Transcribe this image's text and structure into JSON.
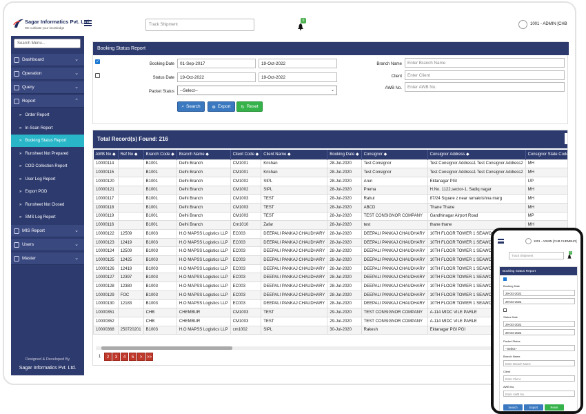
{
  "brand": {
    "name": "Sagar Informatics Pvt. Ltd.",
    "tagline": "We cultivate your knowledge"
  },
  "header": {
    "track_placeholder": "Track Shipment",
    "notif_count": "0",
    "user": "1001 - ADMIN [CHB"
  },
  "sidebar": {
    "search_placeholder": "Search Menu...",
    "items": [
      {
        "label": "Dashboard"
      },
      {
        "label": "Operation"
      },
      {
        "label": "Query"
      },
      {
        "label": "Report"
      }
    ],
    "report_subitems": [
      {
        "label": "Order Report"
      },
      {
        "label": "In-Scan Report"
      },
      {
        "label": "Booking Status Report"
      },
      {
        "label": "Runsheet Not Prepared"
      },
      {
        "label": "COD Collection Report"
      },
      {
        "label": "User Log Report"
      },
      {
        "label": "Export POD"
      },
      {
        "label": "Runsheet Not Closed"
      },
      {
        "label": "SMS Log Report"
      }
    ],
    "bottom_items": [
      {
        "label": "MIS Report"
      },
      {
        "label": "Users"
      },
      {
        "label": "Master"
      }
    ],
    "designed_by": "Designed & Developed By",
    "company": "Sagar Informatics Pvt. Ltd."
  },
  "form": {
    "title": "Booking Status Report",
    "booking_date_label": "Booking Date",
    "booking_from": "01-Sep-2017",
    "booking_to": "19-Oct-2022",
    "status_date_label": "Status Date",
    "status_from": "19-Oct-2022",
    "status_to": "19-Oct-2022",
    "packet_status_label": "Packet Status",
    "packet_status_value": "--Select--",
    "branch_label": "Branch Name",
    "branch_placeholder": "Enter Branch Name",
    "client_label": "Client",
    "client_placeholder": "Enter Client",
    "awb_label": "AWB No.",
    "awb_placeholder": "Enter AWB No.",
    "search_btn": "Search",
    "export_btn": "Export",
    "reset_btn": "Reset"
  },
  "table": {
    "total": "Total Record(s) Found: 216",
    "columns": [
      "AWB No ◆",
      "Ref No ◆",
      "Branch Code ◆",
      "Branch Name ◆",
      "Client Code ◆",
      "Client Name ◆",
      "Booking Date ◆",
      "Consignor ◆",
      "Consignor Address ◆",
      "Consignor State Code ◆",
      "Consignor S"
    ],
    "rows": [
      [
        "10000114",
        "",
        "B1001",
        "Delhi Branch",
        "CM1001",
        "Krishan",
        "28-Jul-2020",
        "Test Consignor",
        "Test Consignor Address1 Test Consignor Address2",
        "MH",
        "MAHARASH"
      ],
      [
        "10000115",
        "",
        "B1001",
        "Delhi Branch",
        "CM1001",
        "Krishan",
        "28-Jul-2020",
        "Test Consignor",
        "Test Consignor Address1 Test Consignor Address2",
        "MH",
        "MAHARASH"
      ],
      [
        "10000120",
        "",
        "B1001",
        "Delhi Branch",
        "CM1002",
        "SIPL",
        "28-Jul-2020",
        "Arun",
        "Ektanagar PGI",
        "UP",
        "Uttar Prades"
      ],
      [
        "10000121",
        "",
        "B1001",
        "Delhi Branch",
        "CM1002",
        "SIPL",
        "28-Jul-2020",
        "Prema",
        "H.No. 1122,sector-1, Sadiq nagar",
        "MH",
        "MAHARASH"
      ],
      [
        "10000117",
        "",
        "B1001",
        "Delhi Branch",
        "CM1003",
        "TEST",
        "28-Jul-2020",
        "Rahul",
        "87/24 Square z near ramakrishna marg",
        "MH",
        "MAHARASH"
      ],
      [
        "10000118",
        "",
        "B1001",
        "Delhi Branch",
        "CM1003",
        "TEST",
        "28-Jul-2020",
        "ABCD",
        "Thane Thane",
        "MH",
        "MAHARASH"
      ],
      [
        "10000119",
        "",
        "B1001",
        "Delhi Branch",
        "CM1003",
        "TEST",
        "28-Jul-2020",
        "TEST CONSIGNOR COMPANY",
        "Gandhinagar Airport Road",
        "MP",
        "Madhya Pra"
      ],
      [
        "10000116",
        "",
        "B1001",
        "Delhi Branch",
        "Cm1010",
        "Zafar",
        "28-Jul-2020",
        "test",
        "thane thane",
        "MH",
        "MAHARASH"
      ],
      [
        "10000122",
        "12509",
        "B1003",
        "H.O MAPSS Logistics LLP",
        "EC003",
        "DEEPALI PANKAJ CHAUDHARY",
        "28-Jul-2020",
        "DEEPALI PANKAJ CHAUDHARY",
        "10TH FLOOR TOWER 1 SEAWOODS",
        "",
        ""
      ],
      [
        "10000123",
        "12419",
        "B1003",
        "H.O MAPSS Logistics LLP",
        "EC003",
        "DEEPALI PANKAJ CHAUDHARY",
        "28-Jul-2020",
        "DEEPALI PANKAJ CHAUDHARY",
        "10TH FLOOR TOWER 1 SEAWOODS",
        "",
        ""
      ],
      [
        "10000124",
        "12509",
        "B1003",
        "H.O MAPSS Logistics LLP",
        "EC003",
        "DEEPALI PANKAJ CHAUDHARY",
        "28-Jul-2020",
        "DEEPALI PANKAJ CHAUDHARY",
        "10TH FLOOR TOWER 1 SEAWOODS",
        "",
        ""
      ],
      [
        "10000125",
        "12425",
        "B1003",
        "H.O MAPSS Logistics LLP",
        "EC003",
        "DEEPALI PANKAJ CHAUDHARY",
        "28-Jul-2020",
        "DEEPALI PANKAJ CHAUDHARY",
        "10TH FLOOR TOWER 1 SEAWOODS",
        "",
        ""
      ],
      [
        "10000126",
        "12419",
        "B1003",
        "H.O MAPSS Logistics LLP",
        "EC003",
        "DEEPALI PANKAJ CHAUDHARY",
        "28-Jul-2020",
        "DEEPALI PANKAJ CHAUDHARY",
        "10TH FLOOR TOWER 1 SEAWOODS",
        "",
        ""
      ],
      [
        "10000127",
        "12397",
        "B1003",
        "H.O MAPSS Logistics LLP",
        "EC003",
        "DEEPALI PANKAJ CHAUDHARY",
        "28-Jul-2020",
        "DEEPALI PANKAJ CHAUDHARY",
        "10TH FLOOR TOWER 1 SEAWOODS",
        "",
        ""
      ],
      [
        "10000128",
        "12380",
        "B1003",
        "H.O MAPSS Logistics LLP",
        "EC003",
        "DEEPALI PANKAJ CHAUDHARY",
        "28-Jul-2020",
        "DEEPALI PANKAJ CHAUDHARY",
        "10TH FLOOR TOWER 1 SEAWOODS",
        "",
        ""
      ],
      [
        "10000129",
        "FOC",
        "B1003",
        "H.O MAPSS Logistics LLP",
        "EC003",
        "DEEPALI PANKAJ CHAUDHARY",
        "28-Jul-2020",
        "DEEPALI PANKAJ CHAUDHARY",
        "10TH FLOOR TOWER 1 SEAWOODS",
        "",
        ""
      ],
      [
        "10000130",
        "12183",
        "B1003",
        "H.O MAPSS Logistics LLP",
        "EC003",
        "DEEPALI PANKAJ CHAUDHARY",
        "28-Jul-2020",
        "DEEPALI PANKAJ CHAUDHARY",
        "10TH FLOOR TOWER 1 SEAWOODS",
        "",
        ""
      ],
      [
        "10000351",
        "",
        "CHB",
        "CHEMBUR",
        "CM1003",
        "TEST",
        "29-Jul-2020",
        "TEST CONSIGNOR COMPANY",
        "A-114 MIDC VILE PARLE",
        "",
        ""
      ],
      [
        "10000352",
        "",
        "CHB",
        "CHEMBUR",
        "CM1003",
        "TEST",
        "29-Jul-2020",
        "TEST CONSIGNOR COMPANY",
        "A-114 MIDC VILE PARLE",
        "",
        ""
      ],
      [
        "10000368",
        "250720201",
        "B1003",
        "H.O MAPSS Logistics LLP",
        "cm1002",
        "SIPL",
        "30-Jul-2020",
        "Rakesh",
        "Ektanagar PGI PGI",
        "",
        ""
      ]
    ],
    "pages": [
      "1",
      "2",
      "3",
      "4",
      "5",
      ">",
      ">>"
    ]
  },
  "mobile": {
    "user": "1001 - ADMIN [CHB CHEMBUR]",
    "track_placeholder": "Track Shipment",
    "notif_count": "0",
    "title": "Booking Status Report",
    "booking_label": "Booking Date",
    "booking_from": "29-Oct-2022",
    "booking_to": "29-Oct-2022",
    "status_label": "Status Date",
    "status_from": "29-Oct-2022",
    "status_to": "29-Oct-2022",
    "packet_label": "Packet Status",
    "packet_value": "--Select--",
    "branch_label": "Branch Name",
    "branch_placeholder": "Enter Branch Name",
    "client_label": "Client",
    "client_placeholder": "Enter Client",
    "awb_label": "AWB No.",
    "awb_placeholder": "Enter AWB No.",
    "search_btn": "Search",
    "export_btn": "Export",
    "reset_btn": "Reset"
  },
  "colors": {
    "navy": "#2d3a6e",
    "active": "#29b6c8",
    "blue_btn": "#3a78c0",
    "green_btn": "#35b34a",
    "pager": "#c0392b"
  }
}
